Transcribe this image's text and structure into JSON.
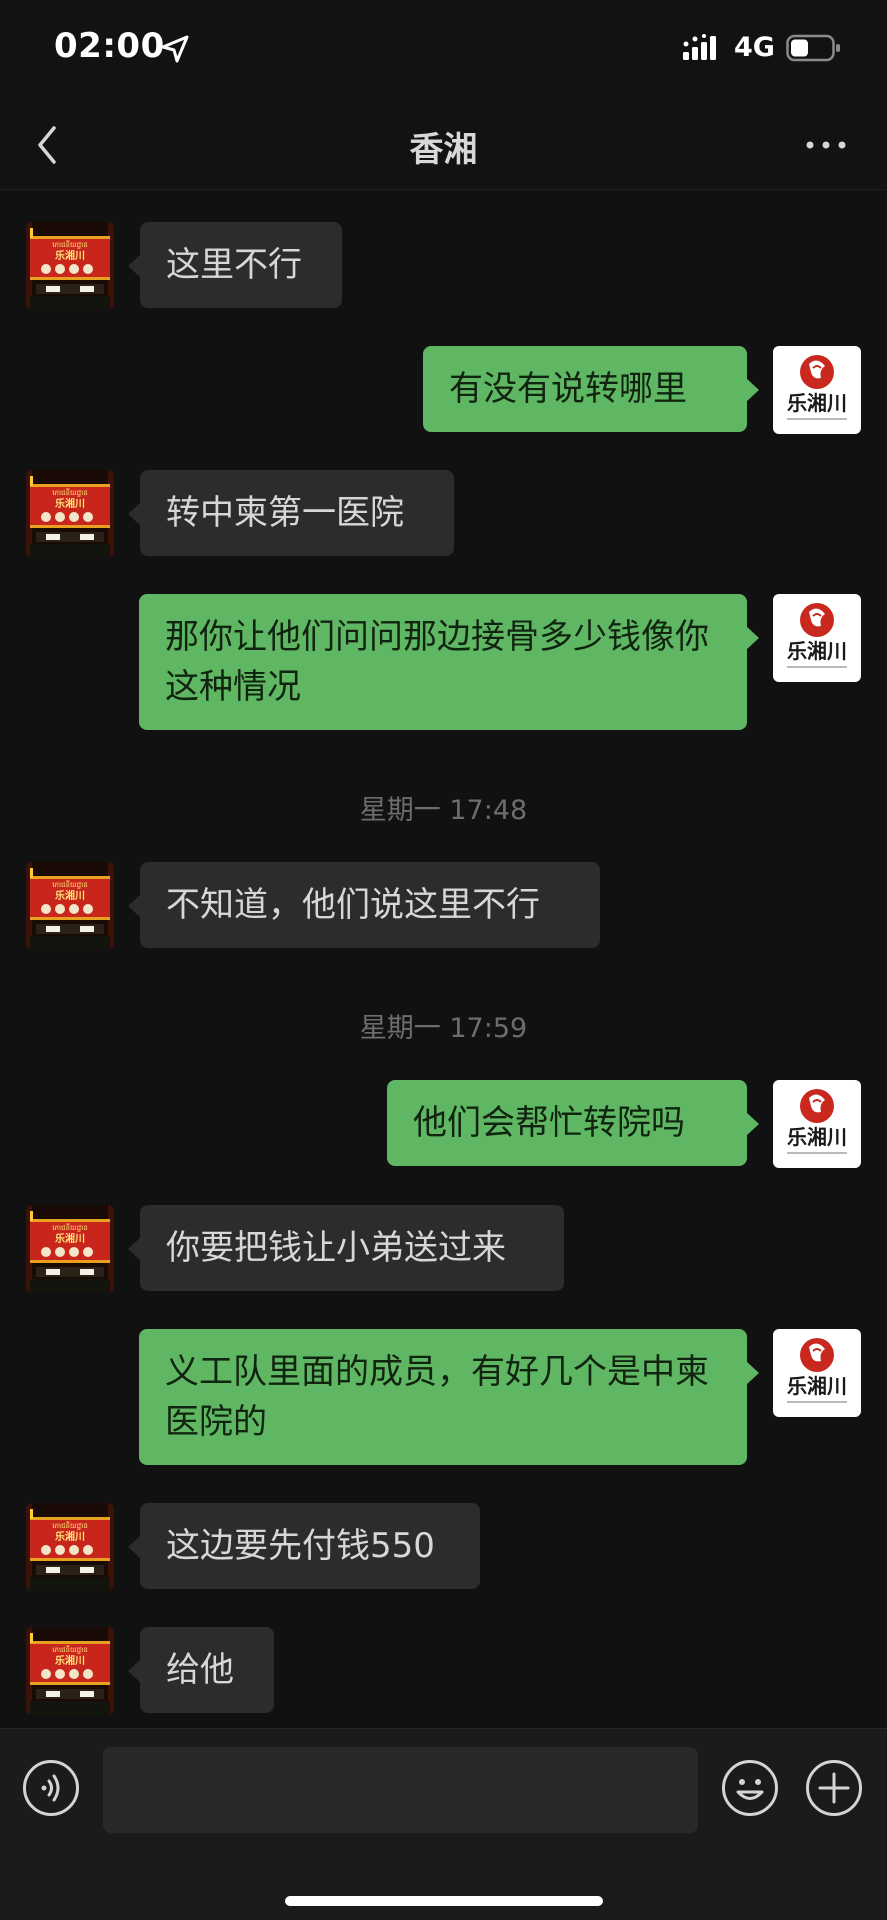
{
  "status_bar": {
    "time": "02:00",
    "network": "4G"
  },
  "header": {
    "title": "香湘"
  },
  "contact_avatar": {
    "line1": "ភោជនីយដ្ឋាន",
    "line2": "乐湘川"
  },
  "my_avatar": {
    "text": "乐湘川"
  },
  "messages": [
    {
      "type": "in",
      "text": "这里不行"
    },
    {
      "type": "out",
      "text": "有没有说转哪里"
    },
    {
      "type": "in",
      "text": "转中柬第一医院"
    },
    {
      "type": "out",
      "text": "那你让他们问问那边接骨多少钱像你这种情况"
    },
    {
      "type": "time",
      "text": "星期一 17:48"
    },
    {
      "type": "in",
      "text": "不知道，他们说这里不行"
    },
    {
      "type": "time",
      "text": "星期一 17:59"
    },
    {
      "type": "out",
      "text": "他们会帮忙转院吗"
    },
    {
      "type": "in",
      "text": "你要把钱让小弟送过来"
    },
    {
      "type": "out",
      "text": "义工队里面的成员，有好几个是中柬医院的"
    },
    {
      "type": "in",
      "text": "这边要先付钱550"
    },
    {
      "type": "in",
      "text": " 给他"
    }
  ],
  "input": {
    "value": ""
  },
  "icons": {
    "back": "chevron-left-icon",
    "more": "more-dots-icon",
    "voice": "voice-icon",
    "emoji": "emoji-icon",
    "plus": "plus-icon"
  },
  "colors": {
    "outgoing_bubble": "#5fb764",
    "incoming_bubble": "#2c2c2c",
    "background": "#111111"
  }
}
